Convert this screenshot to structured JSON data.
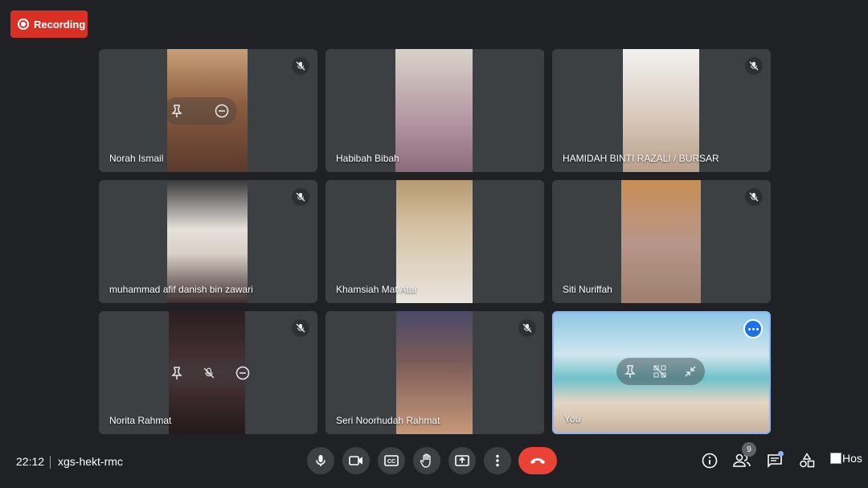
{
  "recording": {
    "label": "Recording"
  },
  "tiles": [
    {
      "name": "Norah Ismail",
      "muted": true,
      "video_colors": [
        "#c9a07a",
        "#5a3a2e"
      ]
    },
    {
      "name": "Habibah Bibah",
      "muted": false,
      "video_colors": [
        "#d8d3c8",
        "#8b6b78"
      ]
    },
    {
      "name": "HAMIDAH BINTI RAZALI / BURSAR",
      "muted": true,
      "video_colors": [
        "#f2f2f0",
        "#b99f8a"
      ]
    },
    {
      "name": "muhammad afif danish bin zawari",
      "muted": true,
      "video_colors": [
        "#3a3a3c",
        "#d8cfc6"
      ]
    },
    {
      "name": "Khamsiah Mat Atar",
      "muted": false,
      "video_colors": [
        "#b79a70",
        "#e8e4de"
      ]
    },
    {
      "name": "Siti Nuriffah",
      "muted": true,
      "video_colors": [
        "#c98e54",
        "#9e7f6e"
      ]
    },
    {
      "name": "Norita Rahmat",
      "muted": true,
      "video_colors": [
        "#2a1f22",
        "#4a3438"
      ]
    },
    {
      "name": "Seri Noorhudah Rahmat",
      "muted": true,
      "video_colors": [
        "#4b4a6a",
        "#c79878"
      ]
    },
    {
      "name": "You",
      "muted": false,
      "video_colors": [
        "#8ec7e3",
        "#c9b29c"
      ]
    }
  ],
  "bottom": {
    "time": "22:12",
    "meeting_code": "xgs-hekt-rmc",
    "participant_count": "9",
    "host_alt": "Hos"
  },
  "colors": {
    "background": "#202124",
    "tile": "#3c4043",
    "recording": "#d93025",
    "hangup": "#ea4335",
    "accent": "#8ab4f8"
  }
}
